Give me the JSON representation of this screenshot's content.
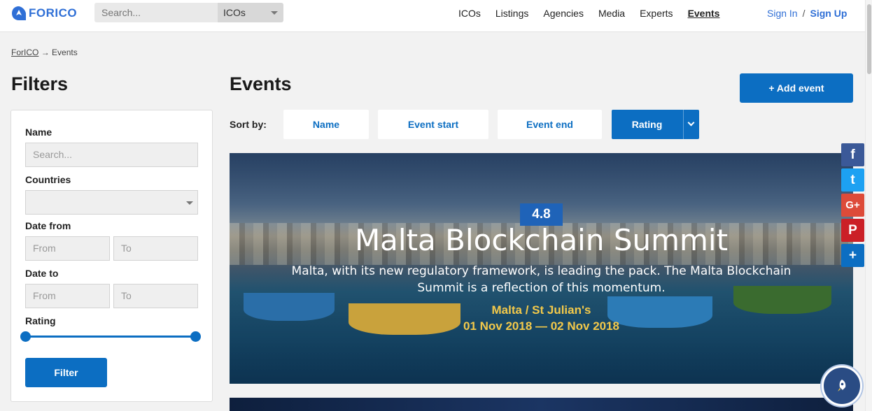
{
  "brand": {
    "name": "FORICO",
    "color": "#2f6fd6"
  },
  "search": {
    "placeholder": "Search...",
    "category": "ICOs"
  },
  "nav": {
    "items": [
      "ICOs",
      "Listings",
      "Agencies",
      "Media",
      "Experts",
      "Events"
    ],
    "active": "Events"
  },
  "auth": {
    "sign_in": "Sign In",
    "separator": "/",
    "sign_up": "Sign Up"
  },
  "breadcrumb": {
    "home": "ForICO",
    "arrow": "→",
    "current": "Events"
  },
  "filters": {
    "title": "Filters",
    "name_label": "Name",
    "name_placeholder": "Search...",
    "countries_label": "Countries",
    "countries_value": "",
    "date_from_label": "Date from",
    "date_to_label": "Date to",
    "from_placeholder": "From",
    "to_placeholder": "To",
    "rating_label": "Rating",
    "rating_range": [
      0,
      1
    ],
    "filter_button": "Filter"
  },
  "events": {
    "title": "Events",
    "add_button": "+ Add event",
    "sort_label": "Sort by:",
    "sort_options": [
      "Name",
      "Event start",
      "Event end",
      "Rating"
    ],
    "active_sort": "Rating"
  },
  "featured_event": {
    "rating": "4.8",
    "title": "Malta Blockchain Summit",
    "description": "Malta, with its new regulatory framework, is leading the pack. The Malta Blockchain Summit is a reflection of this momentum.",
    "location": "Malta / St Julian's",
    "dates": "01 Nov 2018 — 02 Nov 2018"
  },
  "social": [
    {
      "icon": "facebook-icon",
      "glyph": "f",
      "color": "#3b5998"
    },
    {
      "icon": "twitter-icon",
      "glyph": "t",
      "color": "#1da1f2"
    },
    {
      "icon": "google-plus-icon",
      "glyph": "G+",
      "color": "#dd4b39"
    },
    {
      "icon": "pinterest-icon",
      "glyph": "P",
      "color": "#cb2027"
    },
    {
      "icon": "share-plus-icon",
      "glyph": "+",
      "color": "#0c6ec2"
    }
  ],
  "colors": {
    "primary": "#0c6ec2",
    "accent_yellow": "#f3c94a",
    "rating_badge": "#1f63b8"
  }
}
